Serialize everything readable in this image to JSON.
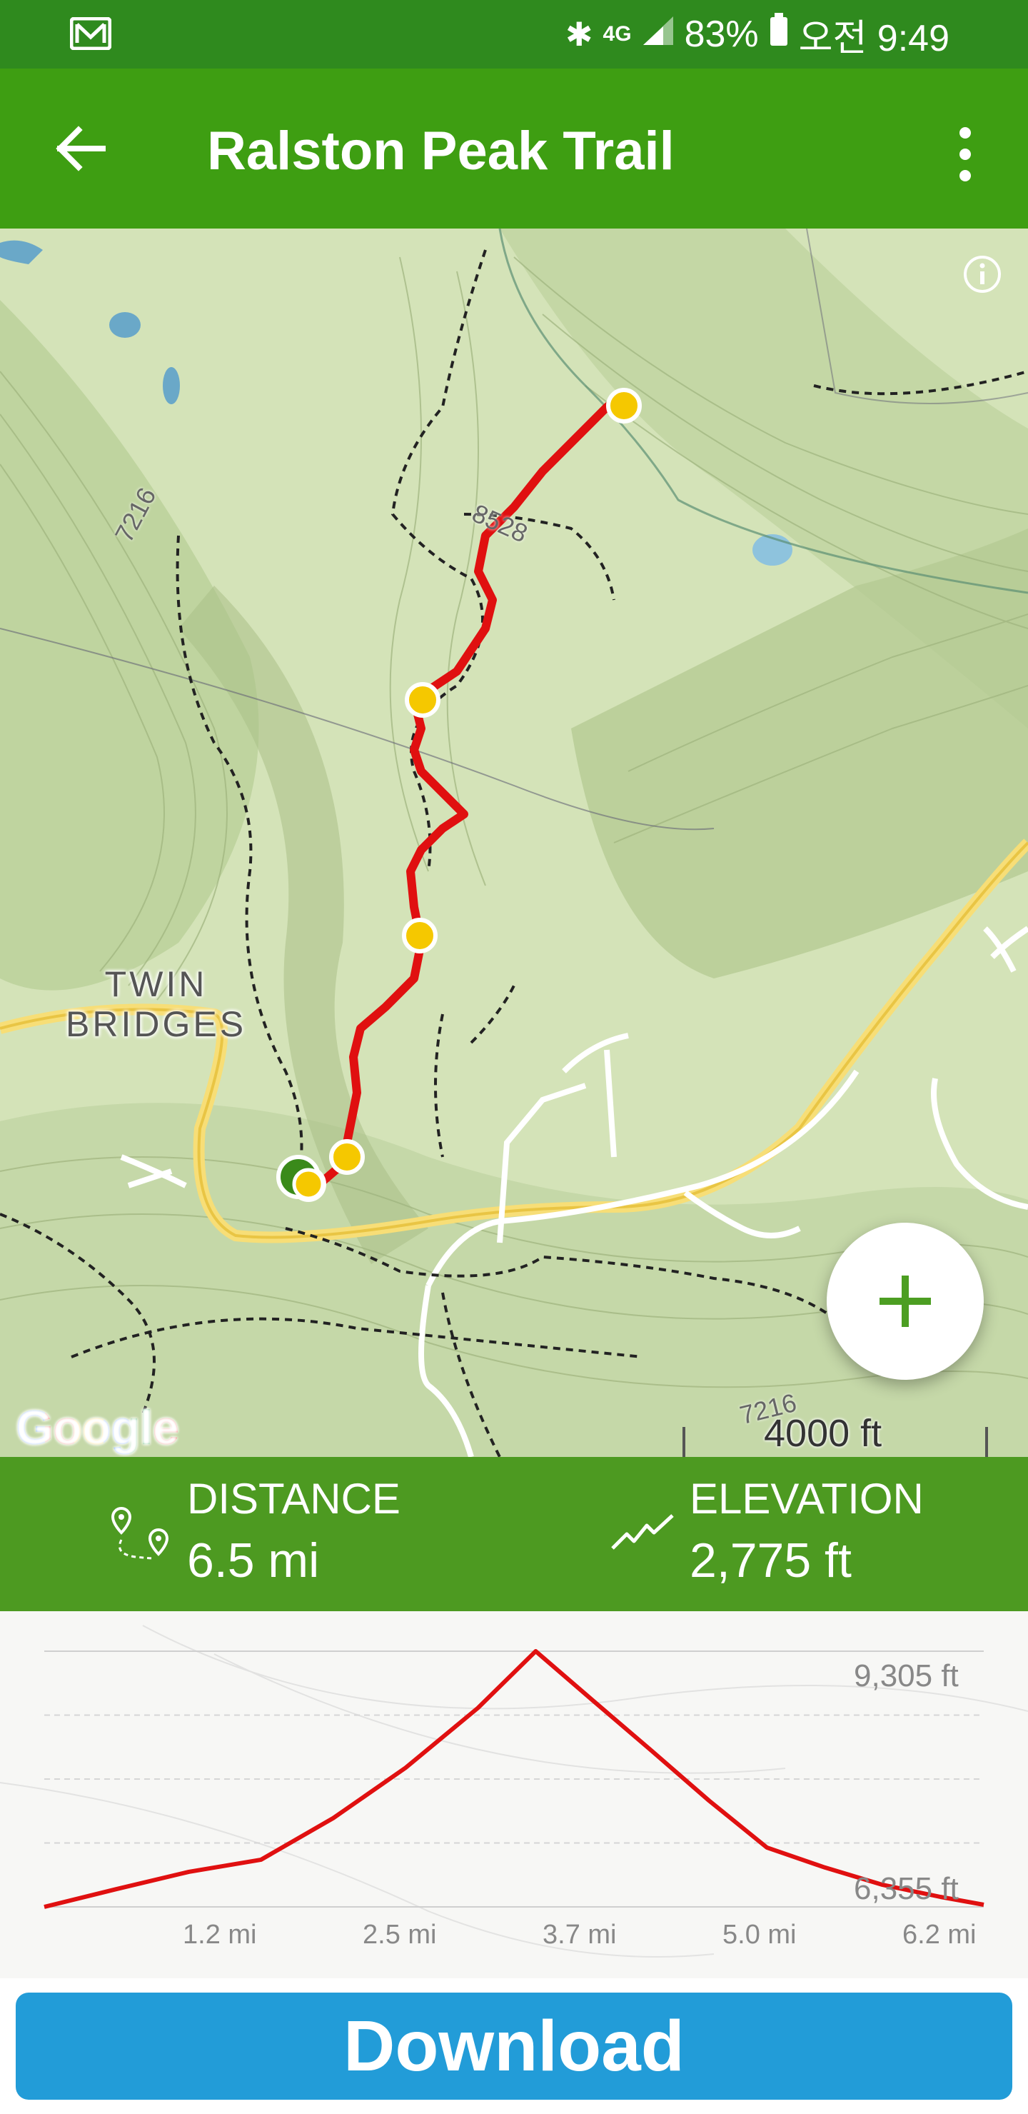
{
  "status_bar": {
    "network": "4G",
    "battery": "83%",
    "time": "오전 9:49"
  },
  "app_bar": {
    "title": "Ralston Peak Trail",
    "back_icon": "arrow-left-icon",
    "menu_icon": "more-vert-icon"
  },
  "map": {
    "place_label_line1": "TWIN",
    "place_label_line2": "BRIDGES",
    "elevation_label_1": "7216",
    "elevation_label_2": "8528",
    "elevation_label_3": "7216",
    "google_logo": "Google",
    "scale_label": "4000 ft",
    "zoom_in_icon": "plus-icon",
    "info_icon": "info-icon"
  },
  "stats": {
    "distance_label": "DISTANCE",
    "distance_value": "6.5 mi",
    "elevation_label": "ELEVATION",
    "elevation_value": "2,775 ft"
  },
  "chart_data": {
    "type": "area",
    "title": "",
    "xlabel": "",
    "ylabel": "",
    "x_tick_labels": [
      "1.2 mi",
      "2.5 mi",
      "3.7 mi",
      "5.0 mi",
      "6.2 mi"
    ],
    "y_tick_labels": [
      "9,305 ft",
      "6,355 ft"
    ],
    "ylim": [
      6355,
      9305
    ],
    "grid": true,
    "x": [
      0,
      0.5,
      1.0,
      1.5,
      2.0,
      2.5,
      3.0,
      3.4,
      3.8,
      4.2,
      4.6,
      5.0,
      5.4,
      5.8,
      6.2,
      6.5
    ],
    "y": [
      6355,
      6560,
      6760,
      6900,
      7380,
      7960,
      8650,
      9305,
      8730,
      8160,
      7580,
      7040,
      6810,
      6610,
      6470,
      6380
    ],
    "line_color": "#e01010"
  },
  "download": {
    "label": "Download"
  },
  "colors": {
    "status_bar": "#2f8a1e",
    "app_bar": "#3e9e12",
    "stats_bar": "#4d9a21",
    "download_button": "#229cd8",
    "trail": "#e01010",
    "waypoint": "#f5c800"
  }
}
